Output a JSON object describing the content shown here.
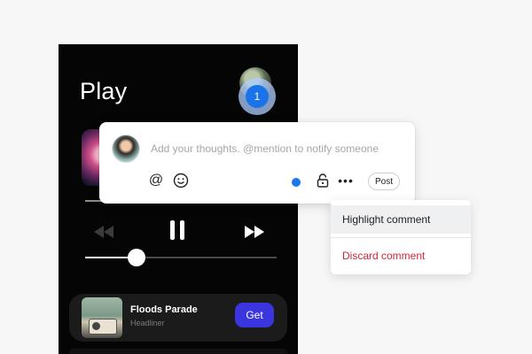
{
  "player": {
    "title": "Play",
    "progress": 0.27,
    "track": {
      "title": "Floods Parade",
      "subtitle": "Headliner",
      "get_label": "Get"
    }
  },
  "badge": {
    "count": "1"
  },
  "comment": {
    "placeholder": "Add your thoughts. @mention to notify someone",
    "post_label": "Post",
    "icons": [
      "at-icon",
      "emoji-icon",
      "lock-icon",
      "more-icon"
    ],
    "status_color": "#1877f2"
  },
  "menu": {
    "items": [
      {
        "label": "Highlight comment"
      },
      {
        "label": "Discard comment"
      }
    ],
    "discard_color": "#d1253f"
  },
  "colors": {
    "accent": "#3b35e0",
    "badge": "#1a73e8"
  }
}
